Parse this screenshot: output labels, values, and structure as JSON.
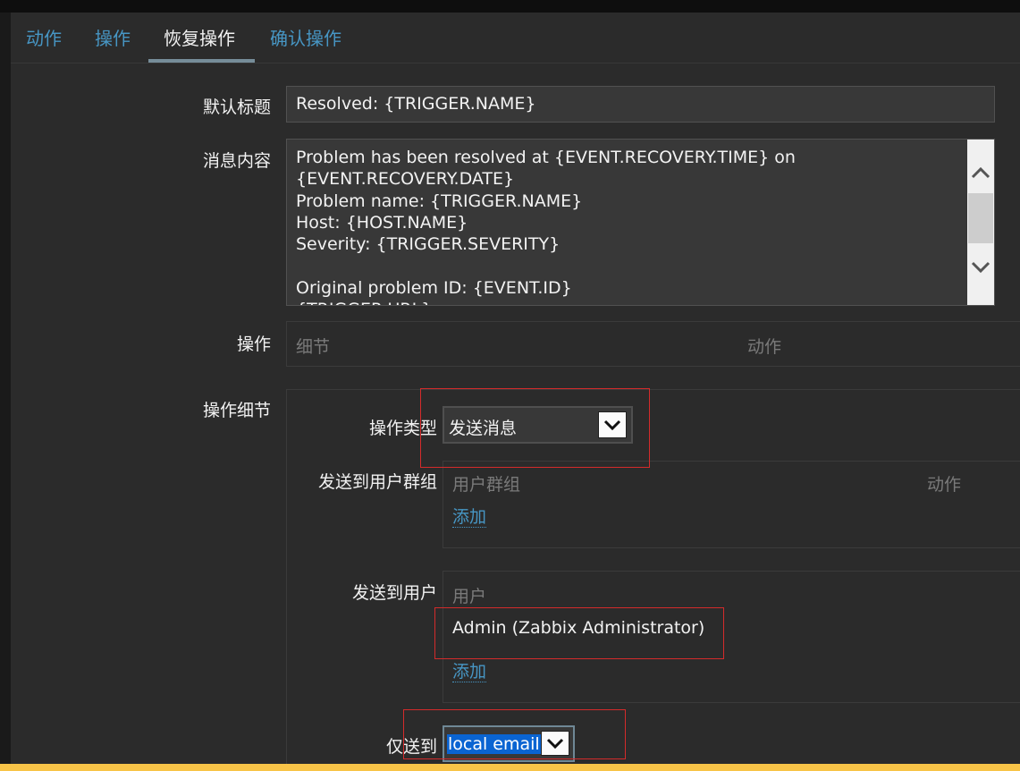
{
  "tabs": [
    {
      "label": "动作"
    },
    {
      "label": "操作"
    },
    {
      "label": "恢复操作"
    },
    {
      "label": "确认操作"
    }
  ],
  "form": {
    "default_subject_label": "默认标题",
    "default_subject_value": "Resolved: {TRIGGER.NAME}",
    "message_label": "消息内容",
    "message_value": "Problem has been resolved at {EVENT.RECOVERY.TIME} on\n{EVENT.RECOVERY.DATE}\nProblem name: {TRIGGER.NAME}\nHost: {HOST.NAME}\nSeverity: {TRIGGER.SEVERITY}\n\nOriginal problem ID: {EVENT.ID}\n{TRIGGER.URL}",
    "operations_label": "操作",
    "operations_col_details": "细节",
    "operations_col_action": "动作",
    "op_details_label": "操作细节"
  },
  "details": {
    "op_type_label": "操作类型",
    "op_type_value": "发送消息",
    "send_groups_label": "发送到用户群组",
    "groups_col_group": "用户群组",
    "groups_col_action": "动作",
    "groups_add": "添加",
    "send_users_label": "发送到用户",
    "users_col_user": "用户",
    "users_row": "Admin (Zabbix Administrator)",
    "users_add": "添加",
    "send_only_label": "仅送到",
    "send_only_value": "local email"
  },
  "icons": {
    "scroll_up": "chevron-up-icon",
    "scroll_down": "chevron-down-icon",
    "select_arrow": "chevron-down-icon"
  },
  "colors": {
    "link": "#4796c4",
    "annotation": "#d42b2b",
    "bottom_strip": "#f8c448"
  }
}
